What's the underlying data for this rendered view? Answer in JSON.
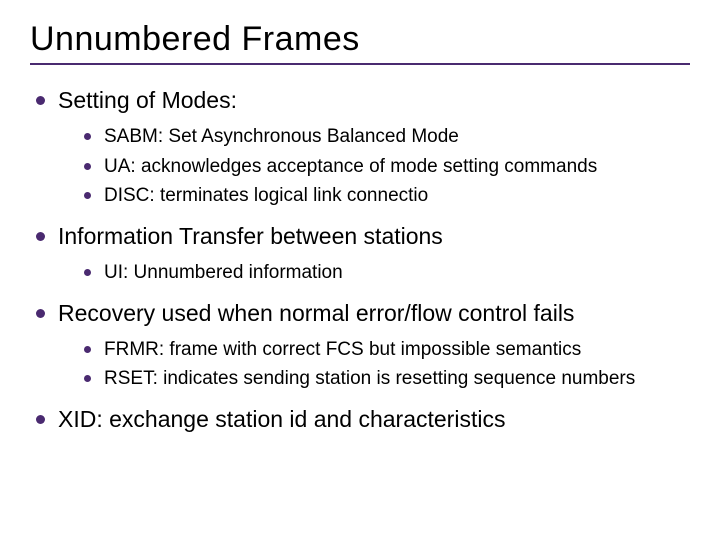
{
  "title": "Unnumbered Frames",
  "items": [
    {
      "text": "Setting of Modes:",
      "subs": [
        {
          "text": "SABM:  Set Asynchronous Balanced Mode"
        },
        {
          "text": "UA: acknowledges acceptance of mode setting commands"
        },
        {
          "text": "DISC:  terminates logical link connectio"
        }
      ]
    },
    {
      "text": "Information Transfer between stations",
      "subs": [
        {
          "text": "UI:  Unnumbered information"
        }
      ]
    },
    {
      "text": "Recovery used when normal error/flow control fails",
      "subs": [
        {
          "text": "FRMR:  frame with correct FCS but impossible semantics"
        },
        {
          "text": "RSET:  indicates sending station is resetting sequence numbers"
        }
      ]
    },
    {
      "text": "XID:  exchange station id and characteristics",
      "subs": []
    }
  ]
}
